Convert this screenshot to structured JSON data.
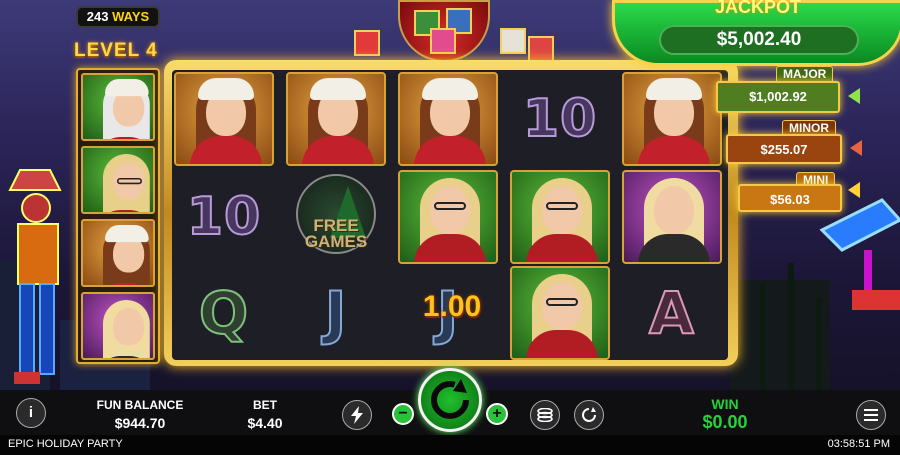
{
  "game": {
    "title": "EPIC HOLIDAY PARTY",
    "clock": "03:58:51 PM"
  },
  "ways": {
    "count": "243",
    "label": "WAYS"
  },
  "level": "LEVEL 4",
  "jackpots": {
    "title": "JACKPOT",
    "grand_value": "$5,002.40",
    "major": {
      "label": "MAJOR",
      "value": "$1,002.92",
      "color": "#4f7d1f"
    },
    "minor": {
      "label": "MINOR",
      "value": "$255.07",
      "color": "#9a4510"
    },
    "mini": {
      "label": "MINI",
      "value": "$56.03",
      "color": "#c87712"
    }
  },
  "reels": {
    "win_amount": "1.00",
    "scatter": {
      "line1": "FREE",
      "line2": "GAMES"
    },
    "symbols": [
      {
        "col": 0,
        "row": 0,
        "kind": "santa-girl",
        "bg": "orange"
      },
      {
        "col": 1,
        "row": 0,
        "kind": "santa-girl",
        "bg": "orange"
      },
      {
        "col": 2,
        "row": 0,
        "kind": "santa-girl",
        "bg": "orange"
      },
      {
        "col": 3,
        "row": 0,
        "kind": "letter",
        "text": "10",
        "style": "ten"
      },
      {
        "col": 4,
        "row": 0,
        "kind": "santa-girl",
        "bg": "orange"
      },
      {
        "col": 0,
        "row": 1,
        "kind": "letter",
        "text": "10",
        "style": "ten"
      },
      {
        "col": 1,
        "row": 1,
        "kind": "scatter"
      },
      {
        "col": 2,
        "row": 1,
        "kind": "glasses-girl",
        "bg": "green"
      },
      {
        "col": 3,
        "row": 1,
        "kind": "glasses-girl",
        "bg": "green"
      },
      {
        "col": 4,
        "row": 1,
        "kind": "blonde-girl",
        "bg": "purple"
      },
      {
        "col": 0,
        "row": 2,
        "kind": "letter",
        "text": "Q",
        "style": "q"
      },
      {
        "col": 1,
        "row": 2,
        "kind": "letter",
        "text": "J",
        "style": "j"
      },
      {
        "col": 2,
        "row": 2,
        "kind": "letter",
        "text": "J",
        "style": "j"
      },
      {
        "col": 3,
        "row": 2,
        "kind": "glasses-girl",
        "bg": "green"
      },
      {
        "col": 4,
        "row": 2,
        "kind": "letter",
        "text": "A",
        "style": "a"
      }
    ]
  },
  "side_column": [
    {
      "kind": "santa-man",
      "bg": "green"
    },
    {
      "kind": "glasses-girl",
      "bg": "green"
    },
    {
      "kind": "santa-girl",
      "bg": "orange"
    },
    {
      "kind": "blonde-girl",
      "bg": "purple"
    }
  ],
  "bottom_bar": {
    "info_icon": "i",
    "fun_balance_label": "FUN BALANCE",
    "fun_balance_value": "$944.70",
    "bet_label": "BET",
    "bet_value": "$4.40",
    "minus": "−",
    "plus": "+",
    "win_label": "WIN",
    "win_value": "$0.00",
    "win_color": "#27d13a",
    "icons": [
      "info-icon",
      "turbo-icon",
      "minus-icon",
      "spin-icon",
      "plus-icon",
      "coins-icon",
      "autoplay-icon",
      "menu-icon"
    ]
  }
}
